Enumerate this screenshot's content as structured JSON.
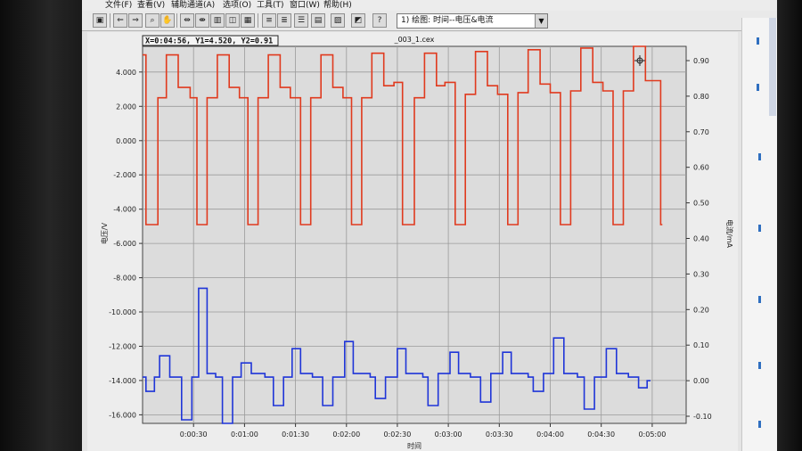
{
  "menu": [
    {
      "label": "文件(F)"
    },
    {
      "label": "查看(V)"
    },
    {
      "label": "辅助通道(A)"
    },
    {
      "label": "选项(O)"
    },
    {
      "label": "工具(T)"
    },
    {
      "label": "窗口(W)"
    },
    {
      "label": "帮助(H)"
    }
  ],
  "toolbar": {
    "view_select_value": "1) 绘图: 时间--电压&电流"
  },
  "chart_data": {
    "type": "line",
    "title": "_003_1.cex",
    "cursor_readout": "X=0:04:56, Y1=4.520, Y2=0.91",
    "xlabel": "时间",
    "ylabel_left": "电压/V",
    "ylabel_right": "电流/mA",
    "xlim": [
      0,
      320
    ],
    "ylim_left": [
      -16.5,
      5.5
    ],
    "ylim_right": [
      -0.12,
      0.94
    ],
    "x_ticks": [
      {
        "x": 30,
        "label": "0:00:30"
      },
      {
        "x": 60,
        "label": "0:01:00"
      },
      {
        "x": 90,
        "label": "0:01:30"
      },
      {
        "x": 120,
        "label": "0:02:00"
      },
      {
        "x": 150,
        "label": "0:02:30"
      },
      {
        "x": 180,
        "label": "0:03:00"
      },
      {
        "x": 210,
        "label": "0:03:30"
      },
      {
        "x": 240,
        "label": "0:04:00"
      },
      {
        "x": 270,
        "label": "0:04:30"
      },
      {
        "x": 300,
        "label": "0:05:00"
      }
    ],
    "y_left_ticks": [
      {
        "v": 4,
        "label": "4.000"
      },
      {
        "v": 2,
        "label": "2.000"
      },
      {
        "v": 0,
        "label": "0.000"
      },
      {
        "v": -2,
        "label": "-2.000"
      },
      {
        "v": -4,
        "label": "-4.000"
      },
      {
        "v": -6,
        "label": "-6.000"
      },
      {
        "v": -8,
        "label": "-8.000"
      },
      {
        "v": -10,
        "label": "-10.000"
      },
      {
        "v": -12,
        "label": "-12.000"
      },
      {
        "v": -14,
        "label": "-14.000"
      },
      {
        "v": -16,
        "label": "-16.000"
      }
    ],
    "y_right_ticks": [
      {
        "v": 0.9,
        "label": "0.90"
      },
      {
        "v": 0.8,
        "label": "0.80"
      },
      {
        "v": 0.7,
        "label": "0.70"
      },
      {
        "v": 0.6,
        "label": "0.60"
      },
      {
        "v": 0.5,
        "label": "0.50"
      },
      {
        "v": 0.4,
        "label": "0.40"
      },
      {
        "v": 0.3,
        "label": "0.30"
      },
      {
        "v": 0.2,
        "label": "0.20"
      },
      {
        "v": 0.1,
        "label": "0.10"
      },
      {
        "v": 0.0,
        "label": "0.00"
      },
      {
        "v": -0.1,
        "label": "-0.10"
      }
    ],
    "grid": true,
    "series": [
      {
        "color": "#e03a1e",
        "axis": "left",
        "points": [
          [
            0,
            5.0
          ],
          [
            2,
            5.0
          ],
          [
            2,
            -4.9
          ],
          [
            9,
            -4.9
          ],
          [
            9,
            2.5
          ],
          [
            14,
            2.5
          ],
          [
            14,
            5.0
          ],
          [
            21,
            5.0
          ],
          [
            21,
            3.1
          ],
          [
            28,
            3.1
          ],
          [
            28,
            2.5
          ],
          [
            32,
            2.5
          ],
          [
            32,
            -4.9
          ],
          [
            38,
            -4.9
          ],
          [
            38,
            2.5
          ],
          [
            44,
            2.5
          ],
          [
            44,
            5.0
          ],
          [
            51,
            5.0
          ],
          [
            51,
            3.1
          ],
          [
            57,
            3.1
          ],
          [
            57,
            2.5
          ],
          [
            62,
            2.5
          ],
          [
            62,
            -4.9
          ],
          [
            68,
            -4.9
          ],
          [
            68,
            2.5
          ],
          [
            74,
            2.5
          ],
          [
            74,
            5.0
          ],
          [
            81,
            5.0
          ],
          [
            81,
            3.1
          ],
          [
            87,
            3.1
          ],
          [
            87,
            2.5
          ],
          [
            93,
            2.5
          ],
          [
            93,
            -4.9
          ],
          [
            99,
            -4.9
          ],
          [
            99,
            2.5
          ],
          [
            105,
            2.5
          ],
          [
            105,
            5.0
          ],
          [
            112,
            5.0
          ],
          [
            112,
            3.1
          ],
          [
            118,
            3.1
          ],
          [
            118,
            2.5
          ],
          [
            123,
            2.5
          ],
          [
            123,
            -4.9
          ],
          [
            129,
            -4.9
          ],
          [
            129,
            2.5
          ],
          [
            135,
            2.5
          ],
          [
            135,
            5.1
          ],
          [
            142,
            5.1
          ],
          [
            142,
            3.2
          ],
          [
            148,
            3.2
          ],
          [
            148,
            3.4
          ],
          [
            153,
            3.4
          ],
          [
            153,
            -4.9
          ],
          [
            160,
            -4.9
          ],
          [
            160,
            2.5
          ],
          [
            166,
            2.5
          ],
          [
            166,
            5.1
          ],
          [
            173,
            5.1
          ],
          [
            173,
            3.2
          ],
          [
            178,
            3.2
          ],
          [
            178,
            3.4
          ],
          [
            184,
            3.4
          ],
          [
            184,
            -4.9
          ],
          [
            190,
            -4.9
          ],
          [
            190,
            2.7
          ],
          [
            196,
            2.7
          ],
          [
            196,
            5.2
          ],
          [
            203,
            5.2
          ],
          [
            203,
            3.2
          ],
          [
            209,
            3.2
          ],
          [
            209,
            2.7
          ],
          [
            215,
            2.7
          ],
          [
            215,
            -4.9
          ],
          [
            221,
            -4.9
          ],
          [
            221,
            2.8
          ],
          [
            227,
            2.8
          ],
          [
            227,
            5.3
          ],
          [
            234,
            5.3
          ],
          [
            234,
            3.3
          ],
          [
            240,
            3.3
          ],
          [
            240,
            2.8
          ],
          [
            246,
            2.8
          ],
          [
            246,
            -4.9
          ],
          [
            252,
            -4.9
          ],
          [
            252,
            2.9
          ],
          [
            258,
            2.9
          ],
          [
            258,
            5.4
          ],
          [
            265,
            5.4
          ],
          [
            265,
            3.4
          ],
          [
            271,
            3.4
          ],
          [
            271,
            2.9
          ],
          [
            277,
            2.9
          ],
          [
            277,
            -4.9
          ],
          [
            283,
            -4.9
          ],
          [
            283,
            2.9
          ],
          [
            289,
            2.9
          ],
          [
            289,
            5.5
          ],
          [
            296,
            5.5
          ],
          [
            296,
            3.5
          ],
          [
            305,
            3.5
          ],
          [
            305,
            -4.9
          ],
          [
            306,
            -4.9
          ]
        ]
      },
      {
        "color": "#1f35d8",
        "axis": "right",
        "points": [
          [
            0,
            0.01
          ],
          [
            2,
            0.01
          ],
          [
            2,
            -0.03
          ],
          [
            7,
            -0.03
          ],
          [
            7,
            0.01
          ],
          [
            10,
            0.01
          ],
          [
            10,
            0.07
          ],
          [
            16,
            0.07
          ],
          [
            16,
            0.01
          ],
          [
            23,
            0.01
          ],
          [
            23,
            -0.11
          ],
          [
            29,
            -0.11
          ],
          [
            29,
            0.01
          ],
          [
            33,
            0.01
          ],
          [
            33,
            0.26
          ],
          [
            38,
            0.26
          ],
          [
            38,
            0.02
          ],
          [
            43,
            0.02
          ],
          [
            43,
            0.01
          ],
          [
            47,
            0.01
          ],
          [
            47,
            -0.12
          ],
          [
            53,
            -0.12
          ],
          [
            53,
            0.01
          ],
          [
            58,
            0.01
          ],
          [
            58,
            0.05
          ],
          [
            64,
            0.05
          ],
          [
            64,
            0.02
          ],
          [
            72,
            0.02
          ],
          [
            72,
            0.01
          ],
          [
            77,
            0.01
          ],
          [
            77,
            -0.07
          ],
          [
            83,
            -0.07
          ],
          [
            83,
            0.01
          ],
          [
            88,
            0.01
          ],
          [
            88,
            0.09
          ],
          [
            93,
            0.09
          ],
          [
            93,
            0.02
          ],
          [
            100,
            0.02
          ],
          [
            100,
            0.01
          ],
          [
            106,
            0.01
          ],
          [
            106,
            -0.07
          ],
          [
            112,
            -0.07
          ],
          [
            112,
            0.01
          ],
          [
            119,
            0.01
          ],
          [
            119,
            0.11
          ],
          [
            124,
            0.11
          ],
          [
            124,
            0.02
          ],
          [
            134,
            0.02
          ],
          [
            134,
            0.01
          ],
          [
            137,
            0.01
          ],
          [
            137,
            -0.05
          ],
          [
            143,
            -0.05
          ],
          [
            143,
            0.01
          ],
          [
            150,
            0.01
          ],
          [
            150,
            0.09
          ],
          [
            155,
            0.09
          ],
          [
            155,
            0.02
          ],
          [
            165,
            0.02
          ],
          [
            165,
            0.01
          ],
          [
            168,
            0.01
          ],
          [
            168,
            -0.07
          ],
          [
            174,
            -0.07
          ],
          [
            174,
            0.02
          ],
          [
            181,
            0.02
          ],
          [
            181,
            0.08
          ],
          [
            186,
            0.08
          ],
          [
            186,
            0.02
          ],
          [
            193,
            0.02
          ],
          [
            193,
            0.01
          ],
          [
            199,
            0.01
          ],
          [
            199,
            -0.06
          ],
          [
            205,
            -0.06
          ],
          [
            205,
            0.02
          ],
          [
            212,
            0.02
          ],
          [
            212,
            0.08
          ],
          [
            217,
            0.08
          ],
          [
            217,
            0.02
          ],
          [
            227,
            0.02
          ],
          [
            227,
            0.01
          ],
          [
            230,
            0.01
          ],
          [
            230,
            -0.03
          ],
          [
            236,
            -0.03
          ],
          [
            236,
            0.02
          ],
          [
            242,
            0.02
          ],
          [
            242,
            0.12
          ],
          [
            248,
            0.12
          ],
          [
            248,
            0.02
          ],
          [
            256,
            0.02
          ],
          [
            256,
            0.01
          ],
          [
            260,
            0.01
          ],
          [
            260,
            -0.08
          ],
          [
            266,
            -0.08
          ],
          [
            266,
            0.01
          ],
          [
            273,
            0.01
          ],
          [
            273,
            0.09
          ],
          [
            279,
            0.09
          ],
          [
            279,
            0.02
          ],
          [
            286,
            0.02
          ],
          [
            286,
            0.01
          ],
          [
            292,
            0.01
          ],
          [
            292,
            -0.02
          ],
          [
            297,
            -0.02
          ],
          [
            297,
            0.0
          ],
          [
            299,
            0.0
          ]
        ]
      }
    ]
  }
}
